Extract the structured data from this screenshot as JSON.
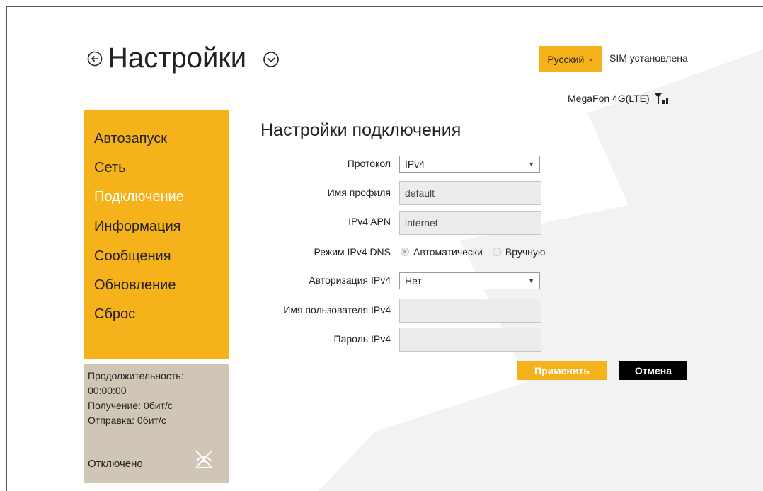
{
  "header": {
    "title": "Настройки",
    "back_icon": "back-circle-arrow-icon",
    "menu_icon": "chevron-down-circle-icon"
  },
  "top_bar": {
    "language": "Русский",
    "sim_status": "SIM установлена",
    "operator": "MegaFon 4G(LTE)"
  },
  "sidebar": {
    "items": [
      {
        "label": "Автозапуск"
      },
      {
        "label": "Сеть"
      },
      {
        "label": "Подключение",
        "active": true
      },
      {
        "label": "Информация"
      },
      {
        "label": "Сообщения"
      },
      {
        "label": "Обновление"
      },
      {
        "label": "Сброс"
      }
    ]
  },
  "status": {
    "duration_label": "Продолжительность:",
    "duration_value": "00:00:00",
    "received": "Получение: 0бит/с",
    "sent": "Отправка: 0бит/с",
    "connection": "Отключено"
  },
  "form": {
    "title": "Настройки подключения",
    "protocol_label": "Протокол",
    "protocol_value": "IPv4",
    "profile_label": "Имя профиля",
    "profile_value": "default",
    "apn_label": "IPv4 APN",
    "apn_value": "internet",
    "dns_label": "Режим IPv4 DNS",
    "dns_options": [
      "Автоматически",
      "Вручную"
    ],
    "auth_label": "Авторизация IPv4",
    "auth_value": "Нет",
    "username_label": "Имя пользователя IPv4",
    "username_value": "",
    "password_label": "Пароль IPv4",
    "password_value": "",
    "apply_label": "Применить",
    "cancel_label": "Отмена"
  },
  "colors": {
    "accent": "#f6b21a",
    "status_panel": "#d0c6b6",
    "active_text": "#ffffff"
  }
}
